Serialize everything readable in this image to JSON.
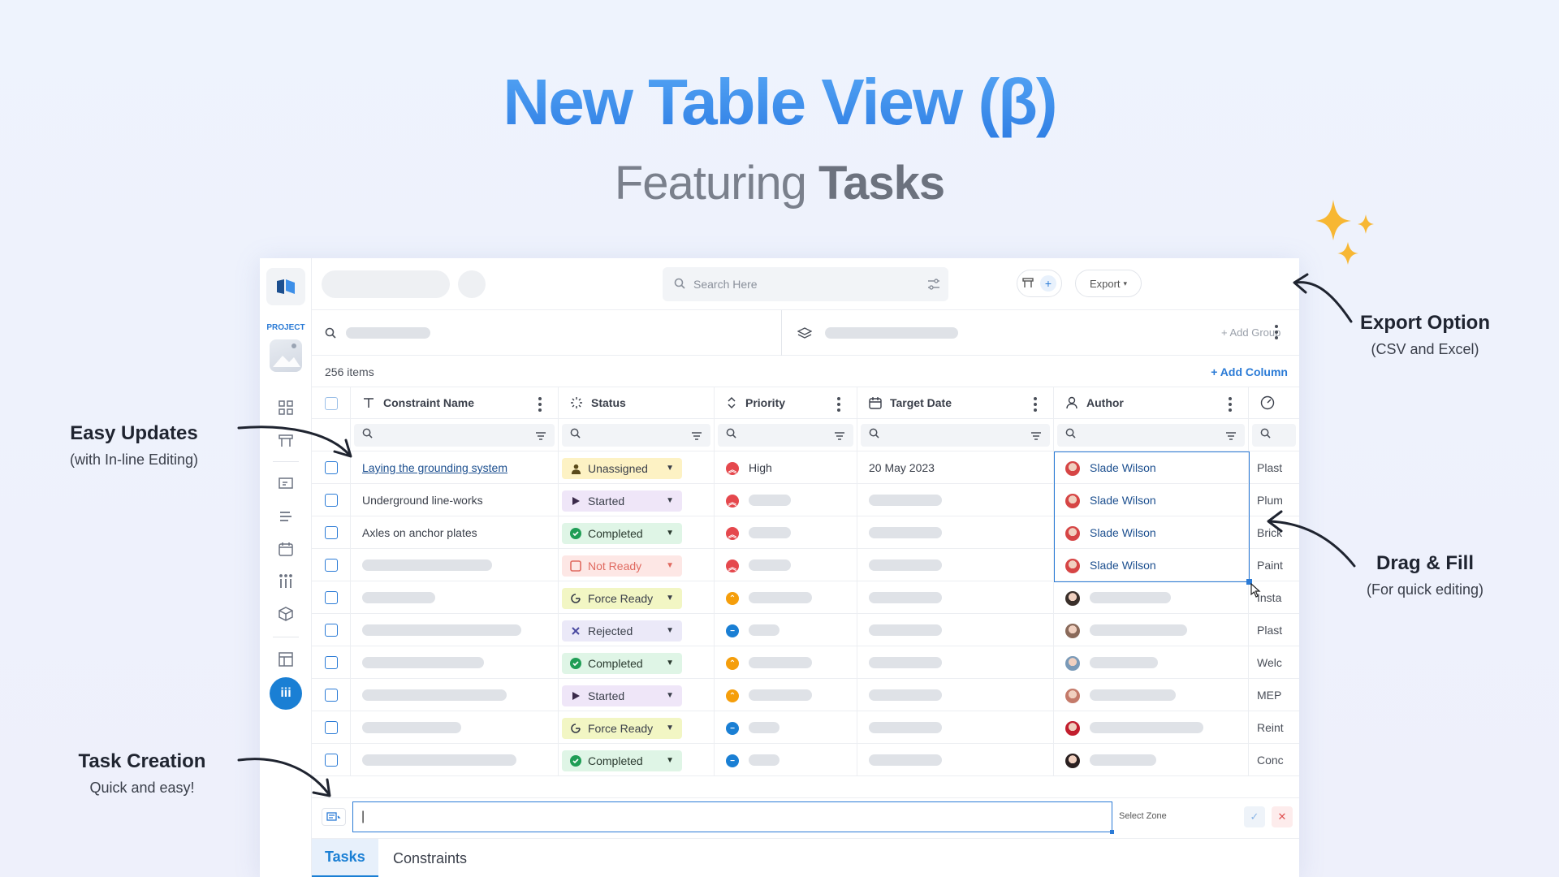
{
  "hero": {
    "title": "New Table View (β)",
    "subtitle_prefix": "Featuring ",
    "subtitle_bold": "Tasks"
  },
  "callouts": {
    "easy_updates": {
      "title": "Easy Updates",
      "sub": "(with In-line Editing)"
    },
    "task_creation": {
      "title": "Task Creation",
      "sub": "Quick and easy!"
    },
    "export_option": {
      "title": "Export Option",
      "sub": "(CSV and Excel)"
    },
    "drag_fill": {
      "title": "Drag & Fill",
      "sub": "(For quick editing)"
    }
  },
  "rail": {
    "project_label": "PROJECT",
    "active_icon": "iii"
  },
  "topbar": {
    "search_placeholder": "Search Here",
    "export_label": "Export",
    "plus": "+"
  },
  "toolbar": {
    "add_group": "+ Add Group"
  },
  "table": {
    "items_count": "256 items",
    "add_column": "+ Add Column",
    "columns": [
      "Constraint Name",
      "Status",
      "Priority",
      "Target Date",
      "Author"
    ],
    "rows": [
      {
        "name": "Laying the grounding system",
        "status": "Unassigned",
        "priority": "High",
        "date": "20 May 2023",
        "author": "Slade Wilson",
        "extra": "Plast"
      },
      {
        "name": "Underground line-works",
        "status": "Started",
        "priority": "",
        "date": "",
        "author": "Slade Wilson",
        "extra": "Plum"
      },
      {
        "name": "Axles on anchor plates",
        "status": "Completed",
        "priority": "",
        "date": "",
        "author": "Slade Wilson",
        "extra": "Brick"
      },
      {
        "name": "",
        "status": "Not Ready",
        "priority": "",
        "date": "",
        "author": "Slade Wilson",
        "extra": "Paint"
      },
      {
        "name": "",
        "status": "Force Ready",
        "priority": "",
        "date": "",
        "author": "",
        "extra": "Insta"
      },
      {
        "name": "",
        "status": "Rejected",
        "priority": "",
        "date": "",
        "author": "",
        "extra": "Plast"
      },
      {
        "name": "",
        "status": "Completed",
        "priority": "",
        "date": "",
        "author": "",
        "extra": "Welc"
      },
      {
        "name": "",
        "status": "Started",
        "priority": "",
        "date": "",
        "author": "",
        "extra": "MEP"
      },
      {
        "name": "",
        "status": "Force Ready",
        "priority": "",
        "date": "",
        "author": "",
        "extra": "Reint"
      },
      {
        "name": "",
        "status": "Completed",
        "priority": "",
        "date": "",
        "author": "",
        "extra": "Conc"
      }
    ]
  },
  "creator": {
    "input_value": "|",
    "zone_label": "Select Zone",
    "ok": "✓",
    "cancel": "✕"
  },
  "tabs": {
    "tasks": "Tasks",
    "constraints": "Constraints"
  },
  "colors": {
    "accent": "#2b7bd6",
    "title_blue": "#3d8fe8"
  }
}
